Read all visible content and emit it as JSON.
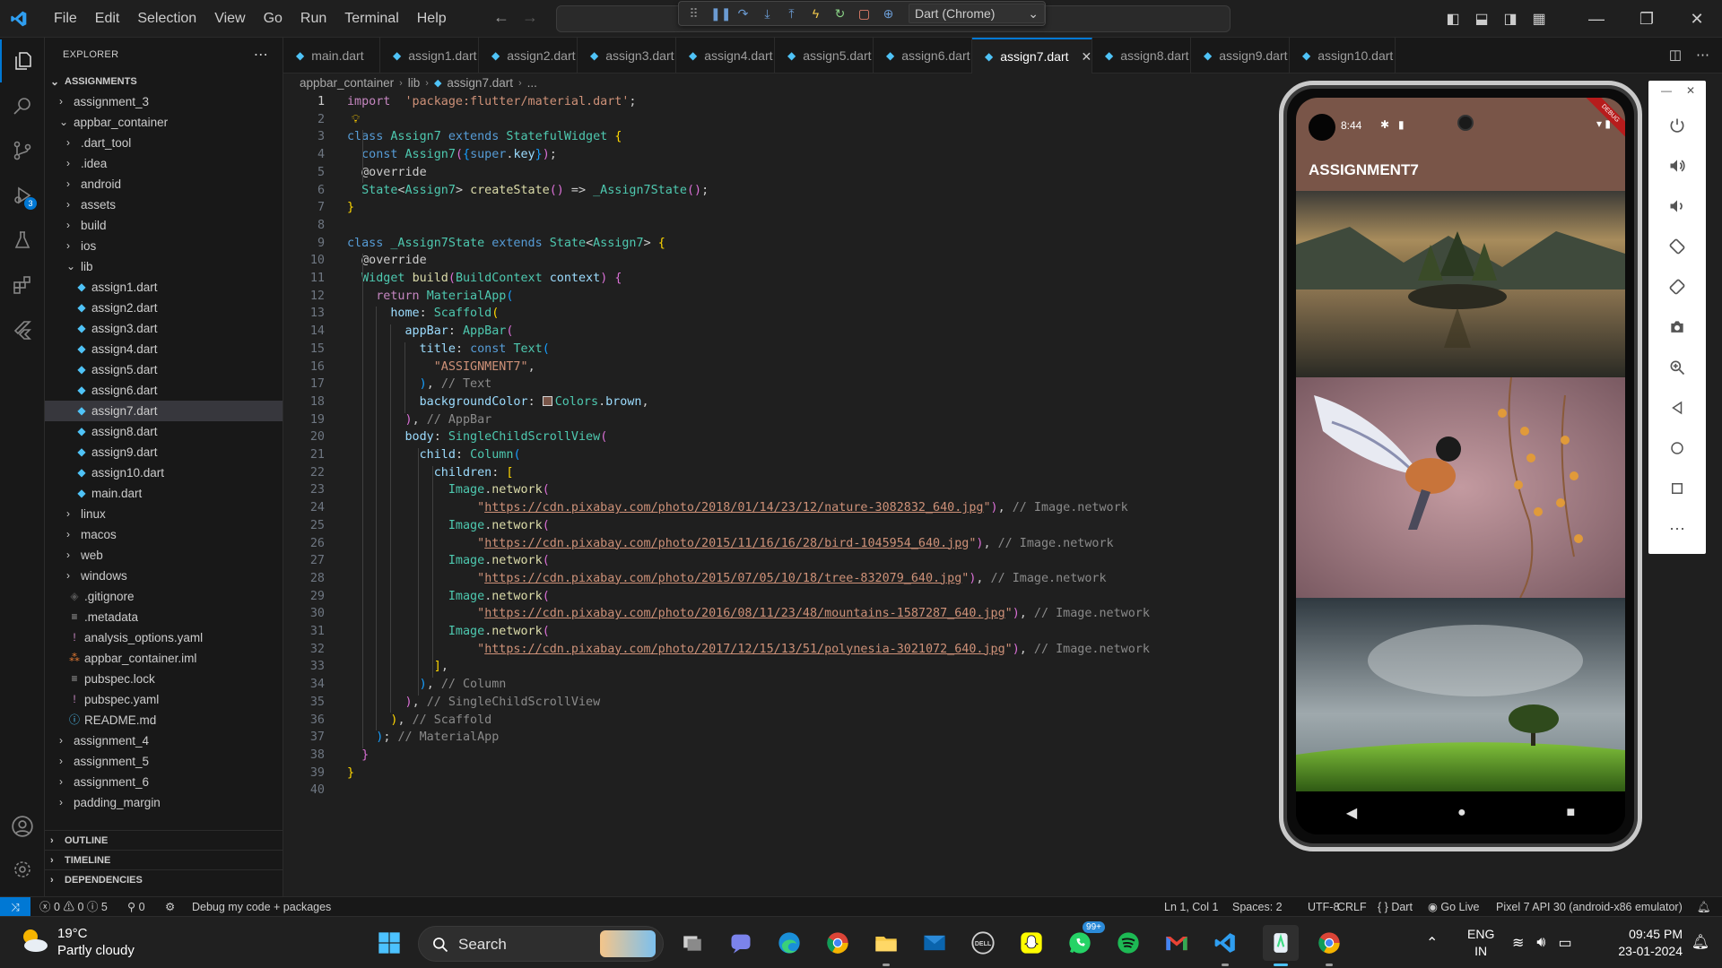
{
  "titlebar": {
    "menu": [
      "File",
      "Edit",
      "Selection",
      "View",
      "Go",
      "Run",
      "Terminal",
      "Help"
    ],
    "debug_target": "Dart (Chrome)"
  },
  "activity": {
    "debug_badge": "3"
  },
  "explorer": {
    "title": "EXPLORER",
    "root": "ASSIGNMENTS",
    "tree": [
      {
        "label": "assignment_3",
        "type": "folder",
        "depth": 1,
        "open": false
      },
      {
        "label": "appbar_container",
        "type": "folder",
        "depth": 1,
        "open": true
      },
      {
        "label": ".dart_tool",
        "type": "folder",
        "depth": 2,
        "open": false
      },
      {
        "label": ".idea",
        "type": "folder",
        "depth": 2,
        "open": false
      },
      {
        "label": "android",
        "type": "folder",
        "depth": 2,
        "open": false
      },
      {
        "label": "assets",
        "type": "folder",
        "depth": 2,
        "open": false
      },
      {
        "label": "build",
        "type": "folder",
        "depth": 2,
        "open": false
      },
      {
        "label": "ios",
        "type": "folder",
        "depth": 2,
        "open": false
      },
      {
        "label": "lib",
        "type": "folder",
        "depth": 2,
        "open": true
      },
      {
        "label": "assign1.dart",
        "type": "dart",
        "depth": 3
      },
      {
        "label": "assign2.dart",
        "type": "dart",
        "depth": 3
      },
      {
        "label": "assign3.dart",
        "type": "dart",
        "depth": 3
      },
      {
        "label": "assign4.dart",
        "type": "dart",
        "depth": 3
      },
      {
        "label": "assign5.dart",
        "type": "dart",
        "depth": 3
      },
      {
        "label": "assign6.dart",
        "type": "dart",
        "depth": 3
      },
      {
        "label": "assign7.dart",
        "type": "dart",
        "depth": 3,
        "selected": true
      },
      {
        "label": "assign8.dart",
        "type": "dart",
        "depth": 3
      },
      {
        "label": "assign9.dart",
        "type": "dart",
        "depth": 3
      },
      {
        "label": "assign10.dart",
        "type": "dart",
        "depth": 3
      },
      {
        "label": "main.dart",
        "type": "dart",
        "depth": 3
      },
      {
        "label": "linux",
        "type": "folder",
        "depth": 2,
        "open": false
      },
      {
        "label": "macos",
        "type": "folder",
        "depth": 2,
        "open": false
      },
      {
        "label": "web",
        "type": "folder",
        "depth": 2,
        "open": false
      },
      {
        "label": "windows",
        "type": "folder",
        "depth": 2,
        "open": false
      },
      {
        "label": ".gitignore",
        "type": "git",
        "depth": 2
      },
      {
        "label": ".metadata",
        "type": "meta",
        "depth": 2
      },
      {
        "label": "analysis_options.yaml",
        "type": "yaml",
        "depth": 2
      },
      {
        "label": "appbar_container.iml",
        "type": "iml",
        "depth": 2
      },
      {
        "label": "pubspec.lock",
        "type": "lock",
        "depth": 2
      },
      {
        "label": "pubspec.yaml",
        "type": "yaml",
        "depth": 2
      },
      {
        "label": "README.md",
        "type": "info",
        "depth": 2
      },
      {
        "label": "assignment_4",
        "type": "folder",
        "depth": 1,
        "open": false
      },
      {
        "label": "assignment_5",
        "type": "folder",
        "depth": 1,
        "open": false
      },
      {
        "label": "assignment_6",
        "type": "folder",
        "depth": 1,
        "open": false
      },
      {
        "label": "padding_margin",
        "type": "folder",
        "depth": 1,
        "open": false
      }
    ],
    "sections": [
      "OUTLINE",
      "TIMELINE",
      "DEPENDENCIES"
    ]
  },
  "tabs": [
    {
      "label": "main.dart",
      "active": false
    },
    {
      "label": "assign1.dart",
      "active": false
    },
    {
      "label": "assign2.dart",
      "active": false
    },
    {
      "label": "assign3.dart",
      "active": false
    },
    {
      "label": "assign4.dart",
      "active": false
    },
    {
      "label": "assign5.dart",
      "active": false
    },
    {
      "label": "assign6.dart",
      "active": false
    },
    {
      "label": "assign7.dart",
      "active": true
    },
    {
      "label": "assign8.dart",
      "active": false
    },
    {
      "label": "assign9.dart",
      "active": false
    },
    {
      "label": "assign10.dart",
      "active": false
    }
  ],
  "breadcrumb": [
    "appbar_container",
    "lib",
    "assign7.dart",
    "..."
  ],
  "editor": {
    "current_line": 1,
    "lines": [
      [
        [
          "k-ctl",
          "import"
        ],
        [
          "",
          "  "
        ],
        [
          "k-str",
          "'package:flutter/material.dart'"
        ],
        [
          "",
          ";"
        ]
      ],
      [],
      [
        [
          "k-kw",
          "class"
        ],
        [
          "",
          " "
        ],
        [
          "k-cls",
          "Assign7"
        ],
        [
          "",
          " "
        ],
        [
          "k-kw",
          "extends"
        ],
        [
          "",
          " "
        ],
        [
          "k-cls",
          "StatefulWidget"
        ],
        [
          "",
          " "
        ],
        [
          "k-p1",
          "{"
        ]
      ],
      [
        [
          "",
          "  "
        ],
        [
          "k-kw",
          "const"
        ],
        [
          "",
          " "
        ],
        [
          "k-cls",
          "Assign7"
        ],
        [
          "k-p2",
          "("
        ],
        [
          "k-p3",
          "{"
        ],
        [
          "k-kw",
          "super"
        ],
        [
          "",
          "."
        ],
        [
          "k-var",
          "key"
        ],
        [
          "k-p3",
          "}"
        ],
        [
          "k-p2",
          ")"
        ],
        [
          "",
          ";"
        ]
      ],
      [
        [
          "",
          "  "
        ],
        [
          "",
          "@override"
        ]
      ],
      [
        [
          "",
          "  "
        ],
        [
          "k-cls",
          "State"
        ],
        [
          "",
          "<"
        ],
        [
          "k-cls",
          "Assign7"
        ],
        [
          "",
          "> "
        ],
        [
          "k-fn",
          "createState"
        ],
        [
          "k-p2",
          "()"
        ],
        [
          "",
          " => "
        ],
        [
          "k-cls",
          "_Assign7State"
        ],
        [
          "k-p2",
          "()"
        ],
        [
          "",
          ";"
        ]
      ],
      [
        [
          "k-p1",
          "}"
        ]
      ],
      [],
      [
        [
          "k-kw",
          "class"
        ],
        [
          "",
          " "
        ],
        [
          "k-cls",
          "_Assign7State"
        ],
        [
          "",
          " "
        ],
        [
          "k-kw",
          "extends"
        ],
        [
          "",
          " "
        ],
        [
          "k-cls",
          "State"
        ],
        [
          "",
          "<"
        ],
        [
          "k-cls",
          "Assign7"
        ],
        [
          "",
          "> "
        ],
        [
          "k-p1",
          "{"
        ]
      ],
      [
        [
          "",
          "  "
        ],
        [
          "",
          "@override"
        ]
      ],
      [
        [
          "",
          "  "
        ],
        [
          "k-cls",
          "Widget"
        ],
        [
          "",
          " "
        ],
        [
          "k-fn",
          "build"
        ],
        [
          "k-p2",
          "("
        ],
        [
          "k-cls",
          "BuildContext"
        ],
        [
          "",
          " "
        ],
        [
          "k-var",
          "context"
        ],
        [
          "k-p2",
          ")"
        ],
        [
          "",
          " "
        ],
        [
          "k-p2",
          "{"
        ]
      ],
      [
        [
          "",
          "    "
        ],
        [
          "k-ctl",
          "return"
        ],
        [
          "",
          " "
        ],
        [
          "k-cls",
          "MaterialApp"
        ],
        [
          "k-p3",
          "("
        ]
      ],
      [
        [
          "",
          "      "
        ],
        [
          "k-var",
          "home"
        ],
        [
          "",
          ": "
        ],
        [
          "k-cls",
          "Scaffold"
        ],
        [
          "k-p1",
          "("
        ]
      ],
      [
        [
          "",
          "        "
        ],
        [
          "k-var",
          "appBar"
        ],
        [
          "",
          ": "
        ],
        [
          "k-cls",
          "AppBar"
        ],
        [
          "k-p2",
          "("
        ]
      ],
      [
        [
          "",
          "          "
        ],
        [
          "k-var",
          "title"
        ],
        [
          "",
          ": "
        ],
        [
          "k-kw",
          "const"
        ],
        [
          "",
          " "
        ],
        [
          "k-cls",
          "Text"
        ],
        [
          "k-p3",
          "("
        ]
      ],
      [
        [
          "",
          "            "
        ],
        [
          "k-str",
          "\"ASSIGNMENT7\""
        ],
        [
          "",
          ","
        ]
      ],
      [
        [
          "",
          "          "
        ],
        [
          "k-p3",
          ")"
        ],
        [
          "",
          ", "
        ],
        [
          "k-cm",
          "// Text"
        ]
      ],
      [
        [
          "",
          "          "
        ],
        [
          "k-var",
          "backgroundColor"
        ],
        [
          "",
          ": "
        ],
        [
          "swatch",
          ""
        ],
        [
          "k-cls",
          "Colors"
        ],
        [
          "",
          "."
        ],
        [
          "k-var",
          "brown"
        ],
        [
          "",
          ","
        ]
      ],
      [
        [
          "",
          "        "
        ],
        [
          "k-p2",
          ")"
        ],
        [
          "",
          ", "
        ],
        [
          "k-cm",
          "// AppBar"
        ]
      ],
      [
        [
          "",
          "        "
        ],
        [
          "k-var",
          "body"
        ],
        [
          "",
          ": "
        ],
        [
          "k-cls",
          "SingleChildScrollView"
        ],
        [
          "k-p2",
          "("
        ]
      ],
      [
        [
          "",
          "          "
        ],
        [
          "k-var",
          "child"
        ],
        [
          "",
          ": "
        ],
        [
          "k-cls",
          "Column"
        ],
        [
          "k-p3",
          "("
        ]
      ],
      [
        [
          "",
          "            "
        ],
        [
          "k-var",
          "children"
        ],
        [
          "",
          ": "
        ],
        [
          "k-p1",
          "["
        ]
      ],
      [
        [
          "",
          "              "
        ],
        [
          "k-cls",
          "Image"
        ],
        [
          "",
          "."
        ],
        [
          "k-fn",
          "network"
        ],
        [
          "k-p2",
          "("
        ]
      ],
      [
        [
          "",
          "                  "
        ],
        [
          "k-str",
          "\""
        ],
        [
          "k-url",
          "https://cdn.pixabay.com/photo/2018/01/14/23/12/nature-3082832_640.jpg"
        ],
        [
          "k-str",
          "\""
        ],
        [
          "k-p2",
          ")"
        ],
        [
          "",
          ", "
        ],
        [
          "k-cm",
          "// Image.network"
        ]
      ],
      [
        [
          "",
          "              "
        ],
        [
          "k-cls",
          "Image"
        ],
        [
          "",
          "."
        ],
        [
          "k-fn",
          "network"
        ],
        [
          "k-p2",
          "("
        ]
      ],
      [
        [
          "",
          "                  "
        ],
        [
          "k-str",
          "\""
        ],
        [
          "k-url",
          "https://cdn.pixabay.com/photo/2015/11/16/16/28/bird-1045954_640.jpg"
        ],
        [
          "k-str",
          "\""
        ],
        [
          "k-p2",
          ")"
        ],
        [
          "",
          ", "
        ],
        [
          "k-cm",
          "// Image.network"
        ]
      ],
      [
        [
          "",
          "              "
        ],
        [
          "k-cls",
          "Image"
        ],
        [
          "",
          "."
        ],
        [
          "k-fn",
          "network"
        ],
        [
          "k-p2",
          "("
        ]
      ],
      [
        [
          "",
          "                  "
        ],
        [
          "k-str",
          "\""
        ],
        [
          "k-url",
          "https://cdn.pixabay.com/photo/2015/07/05/10/18/tree-832079_640.jpg"
        ],
        [
          "k-str",
          "\""
        ],
        [
          "k-p2",
          ")"
        ],
        [
          "",
          ", "
        ],
        [
          "k-cm",
          "// Image.network"
        ]
      ],
      [
        [
          "",
          "              "
        ],
        [
          "k-cls",
          "Image"
        ],
        [
          "",
          "."
        ],
        [
          "k-fn",
          "network"
        ],
        [
          "k-p2",
          "("
        ]
      ],
      [
        [
          "",
          "                  "
        ],
        [
          "k-str",
          "\""
        ],
        [
          "k-url",
          "https://cdn.pixabay.com/photo/2016/08/11/23/48/mountains-1587287_640.jpg"
        ],
        [
          "k-str",
          "\""
        ],
        [
          "k-p2",
          ")"
        ],
        [
          "",
          ", "
        ],
        [
          "k-cm",
          "// Image.network"
        ]
      ],
      [
        [
          "",
          "              "
        ],
        [
          "k-cls",
          "Image"
        ],
        [
          "",
          "."
        ],
        [
          "k-fn",
          "network"
        ],
        [
          "k-p2",
          "("
        ]
      ],
      [
        [
          "",
          "                  "
        ],
        [
          "k-str",
          "\""
        ],
        [
          "k-url",
          "https://cdn.pixabay.com/photo/2017/12/15/13/51/polynesia-3021072_640.jpg"
        ],
        [
          "k-str",
          "\""
        ],
        [
          "k-p2",
          ")"
        ],
        [
          "",
          ", "
        ],
        [
          "k-cm",
          "// Image.network"
        ]
      ],
      [
        [
          "",
          "            "
        ],
        [
          "k-p1",
          "]"
        ],
        [
          "",
          ","
        ]
      ],
      [
        [
          "",
          "          "
        ],
        [
          "k-p3",
          ")"
        ],
        [
          "",
          ", "
        ],
        [
          "k-cm",
          "// Column"
        ]
      ],
      [
        [
          "",
          "        "
        ],
        [
          "k-p2",
          ")"
        ],
        [
          "",
          ", "
        ],
        [
          "k-cm",
          "// SingleChildScrollView"
        ]
      ],
      [
        [
          "",
          "      "
        ],
        [
          "k-p1",
          ")"
        ],
        [
          "",
          ", "
        ],
        [
          "k-cm",
          "// Scaffold"
        ]
      ],
      [
        [
          "",
          "    "
        ],
        [
          "k-p3",
          ")"
        ],
        [
          "",
          "; "
        ],
        [
          "k-cm",
          "// MaterialApp"
        ]
      ],
      [
        [
          "",
          "  "
        ],
        [
          "k-p2",
          "}"
        ]
      ],
      [
        [
          "k-p1",
          "}"
        ]
      ],
      []
    ]
  },
  "emulator": {
    "time": "8:44",
    "app_title": "ASSIGNMENT7",
    "appbar_color": "#795548",
    "debug_banner": "DEBUG"
  },
  "statusbar": {
    "errors": "0",
    "warnings": "0",
    "info": "5",
    "ports": "0",
    "debug_label": "Debug my code + packages",
    "position": "Ln 1, Col 1",
    "spaces": "Spaces: 2",
    "encoding": "UTF-8",
    "eol": "CRLF",
    "language": "Dart",
    "golive": "Go Live",
    "device": "Pixel 7 API 30 (android-x86 emulator)"
  },
  "taskbar": {
    "temperature": "19°C",
    "condition": "Partly cloudy",
    "search": "Search",
    "whatsapp_badge": "99+",
    "lang1": "ENG",
    "lang2": "IN",
    "time": "09:45 PM",
    "date": "23-01-2024"
  }
}
